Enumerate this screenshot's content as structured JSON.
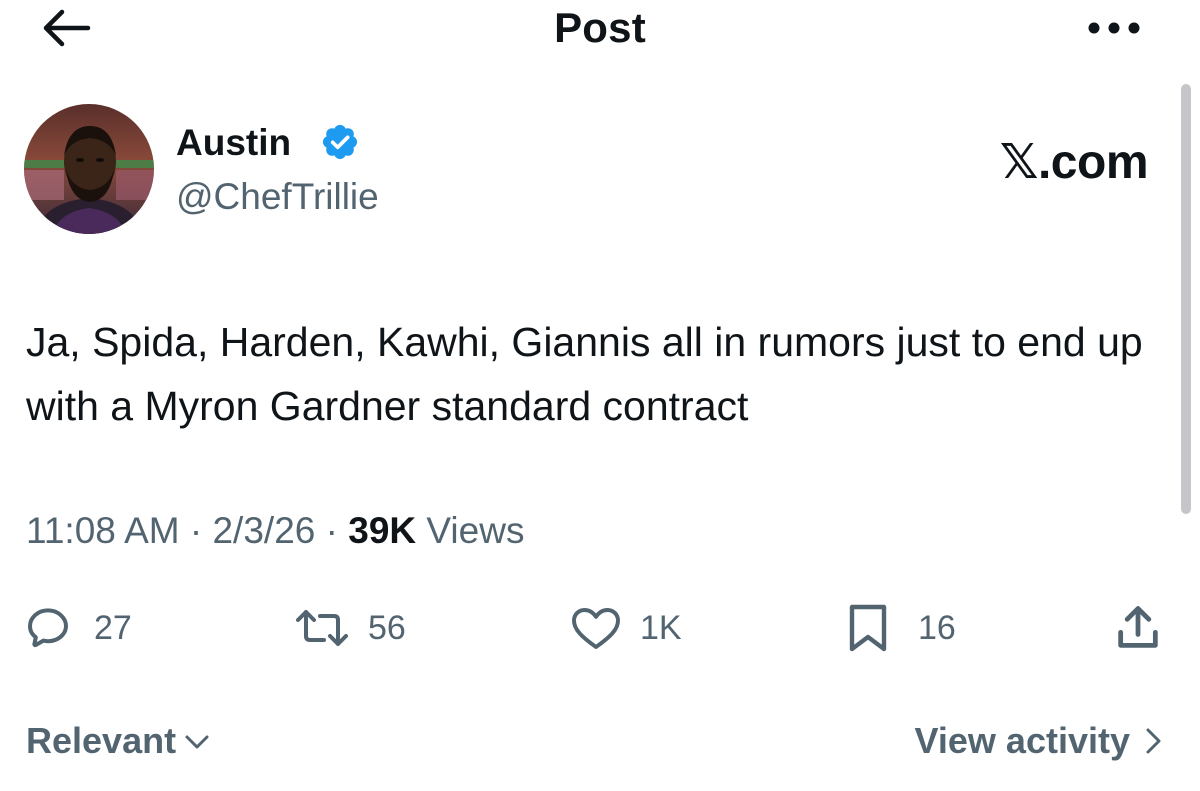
{
  "header": {
    "title": "Post",
    "back_icon": "arrow-left-icon",
    "more_icon": "more-horizontal-icon"
  },
  "author": {
    "name": "Austin",
    "handle": "@ChefTrillie",
    "verified": true,
    "badge_color": "#1d9bf0"
  },
  "watermark": "𝕏.com",
  "post": {
    "text": "Ja, Spida, Harden, Kawhi, Giannis all in rumors just to end up with a Myron Gardner standard contract",
    "time": "11:08 AM",
    "separator": "·",
    "date": "2/3/26",
    "views_count": "39K",
    "views_label": "Views"
  },
  "actions": {
    "replies": "27",
    "reposts": "56",
    "likes": "1K",
    "bookmarks": "16"
  },
  "footer": {
    "sort_label": "Relevant",
    "activity_label": "View activity"
  },
  "colors": {
    "text_primary": "#0f1419",
    "text_secondary": "#536471",
    "accent": "#1d9bf0"
  }
}
